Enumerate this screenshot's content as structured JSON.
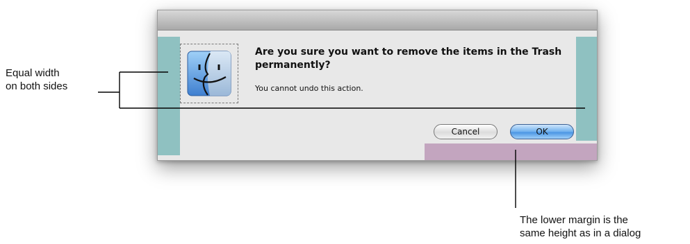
{
  "dialog": {
    "heading": "Are you sure you want to remove the items in the Trash permanently?",
    "message": "You cannot undo this action.",
    "cancel_label": "Cancel",
    "ok_label": "OK",
    "icon": "finder-icon"
  },
  "annotations": {
    "left_line1": "Equal width",
    "left_line2": "on both sides",
    "bottom_line1": "The lower margin is the",
    "bottom_line2": "same height as in a dialog"
  },
  "colors": {
    "side_margin": "#8fc1c1",
    "bottom_margin": "#c3a5bf",
    "dialog_bg": "#e8e8e8",
    "ok_button": "#5aa2eb"
  }
}
